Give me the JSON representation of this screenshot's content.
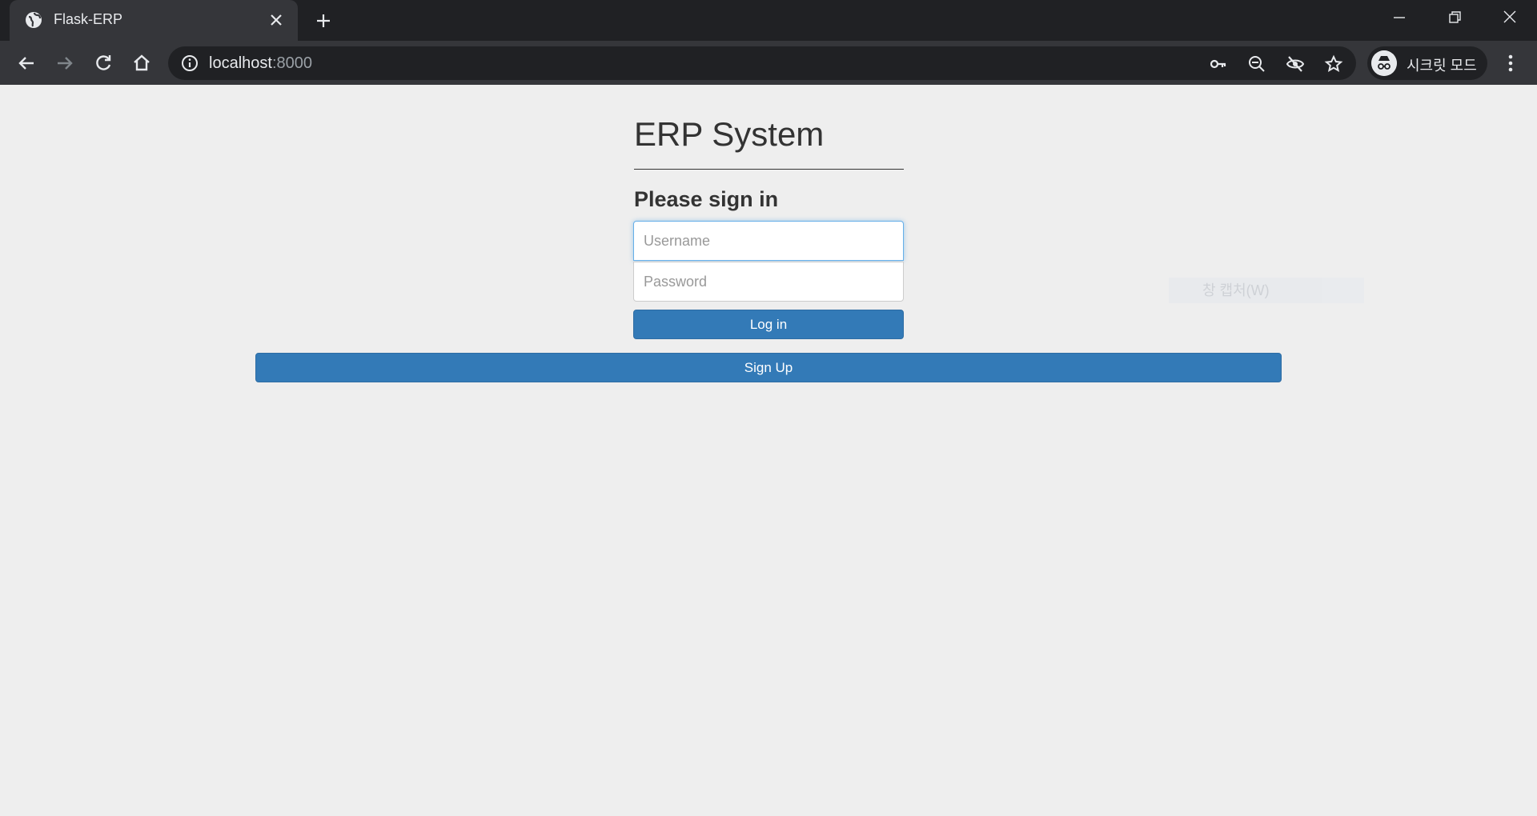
{
  "browser": {
    "tab": {
      "title": "Flask-ERP"
    },
    "address": {
      "host": "localhost",
      "port": ":8000"
    },
    "profile": {
      "label": "시크릿 모드"
    },
    "colors": {
      "frame": "#202124",
      "toolbar": "#35363a",
      "icon": "#e8eaed"
    }
  },
  "page": {
    "heading": "ERP System",
    "subheading": "Please sign in",
    "username_placeholder": "Username",
    "password_placeholder": "Password",
    "login_label": "Log in",
    "signup_label": "Sign Up",
    "ghost_label": "창 캡처(W)",
    "colors": {
      "background": "#eeeeee",
      "primary": "#337ab7",
      "focus": "#66afe9"
    }
  }
}
